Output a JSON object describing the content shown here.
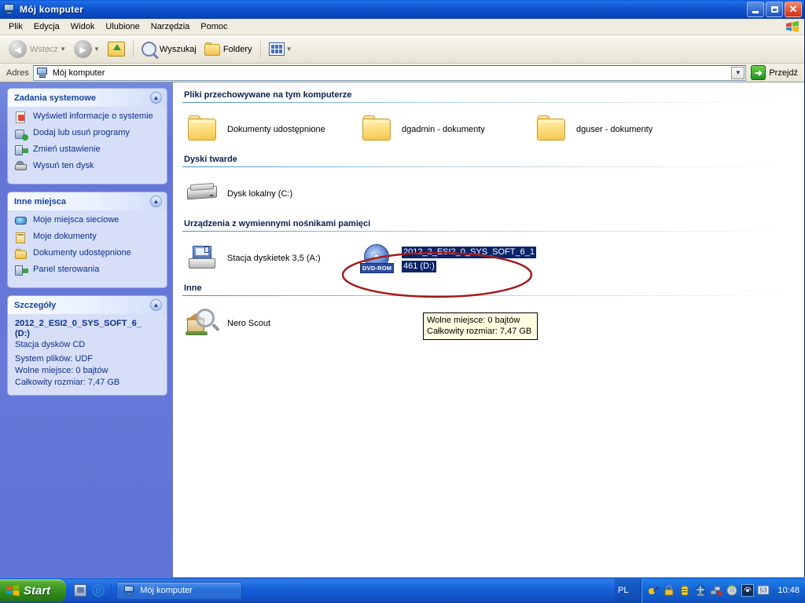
{
  "window": {
    "title": "Mój komputer",
    "icon": "my-computer-icon",
    "buttons": {
      "minimize": "_",
      "maximize": "❐",
      "close": "✕"
    }
  },
  "menubar": {
    "items": [
      {
        "label": "Plik"
      },
      {
        "label": "Edycja"
      },
      {
        "label": "Widok"
      },
      {
        "label": "Ulubione"
      },
      {
        "label": "Narzędzia"
      },
      {
        "label": "Pomoc"
      }
    ],
    "brand_icon": "windows-flag-icon"
  },
  "toolbar": {
    "back_label": "Wstecz",
    "forward_label": "",
    "up_label": "",
    "search_label": "Wyszukaj",
    "folders_label": "Foldery",
    "views_label": ""
  },
  "address": {
    "label": "Adres",
    "value": "Mój komputer",
    "go_label": "Przejdź"
  },
  "sidebar": {
    "panels": [
      {
        "title": "Zadania systemowe",
        "items": [
          {
            "label": "Wyświetl informacje o systemie",
            "icon": "system-info-icon"
          },
          {
            "label": "Dodaj lub usuń programy",
            "icon": "add-remove-programs-icon"
          },
          {
            "label": "Zmień ustawienie",
            "icon": "settings-icon"
          },
          {
            "label": "Wysuń ten dysk",
            "icon": "eject-disk-icon"
          }
        ]
      },
      {
        "title": "Inne miejsca",
        "items": [
          {
            "label": "Moje miejsca sieciowe",
            "icon": "network-places-icon"
          },
          {
            "label": "Moje dokumenty",
            "icon": "my-documents-icon"
          },
          {
            "label": "Dokumenty udostępnione",
            "icon": "shared-documents-icon"
          },
          {
            "label": "Panel sterowania",
            "icon": "control-panel-icon"
          }
        ]
      }
    ],
    "details": {
      "title": "Szczegóły",
      "name_line1": "2012_2_ESI2_0_SYS_SOFT_6_",
      "name_line2": "(D:)",
      "type": "Stacja dysków CD",
      "filesystem": "System plików: UDF",
      "free_space": "Wolne miejsce: 0 bajtów",
      "total_size": "Całkowity rozmiar: 7,47 GB"
    }
  },
  "content": {
    "groups": [
      {
        "header": "Pliki przechowywane na tym komputerze",
        "items": [
          {
            "label": "Dokumenty udostępnione",
            "icon": "folder-icon",
            "selected": false
          },
          {
            "label": "dgadmin - dokumenty",
            "icon": "folder-icon",
            "selected": false
          },
          {
            "label": "dguser - dokumenty",
            "icon": "folder-icon",
            "selected": false
          }
        ]
      },
      {
        "header": "Dyski twarde",
        "items": [
          {
            "label": "Dysk lokalny (C:)",
            "icon": "hard-disk-icon",
            "selected": false
          }
        ]
      },
      {
        "header": "Urządzenia z wymiennymi nośnikami pamięci",
        "items": [
          {
            "label": "Stacja dyskietek 3,5 (A:)",
            "icon": "floppy-drive-icon",
            "selected": false
          },
          {
            "label_line1": "2012_2_ESI2_0_SYS_SOFT_6_1",
            "label_line2": "461 (D:)",
            "icon": "dvd-rom-icon",
            "badge": "DVD-ROM",
            "selected": true
          }
        ]
      },
      {
        "header": "Inne",
        "items": [
          {
            "label": "Nero Scout",
            "icon": "nero-scout-icon",
            "selected": false
          }
        ]
      }
    ]
  },
  "tooltip": {
    "line1": "Wolne miejsce: 0 bajtów",
    "line2": "Całkowity rozmiar: 7,47 GB"
  },
  "annotation": {
    "shape": "ellipse",
    "color": "#a31b1b"
  },
  "taskbar": {
    "start_label": "Start",
    "quicklaunch": [
      {
        "icon": "show-desktop-icon"
      },
      {
        "icon": "internet-explorer-icon"
      }
    ],
    "tasks": [
      {
        "label": "Mój komputer",
        "icon": "my-computer-icon",
        "active": true
      }
    ],
    "tray": {
      "language": "PL",
      "icons": [
        "nero-tray-icon",
        "security-lock-icon",
        "battery-icon",
        "antivirus-icon",
        "network-disconnected-icon",
        "disc-tray-icon",
        "wireless-icon",
        "monitor-icon"
      ],
      "clock": "10:48"
    }
  },
  "colors": {
    "titlebar_blue": "#0f54cf",
    "sidebar_blue": "#6375d6",
    "panel_blue": "#d6dff7",
    "panel_title": "#16459e",
    "link_blue": "#0b2f8e",
    "selection": "#0a246a",
    "annotation_red": "#a31b1b",
    "tooltip_bg": "#ffffe1",
    "taskbar_blue": "#1861da",
    "start_green": "#2f8a1c"
  }
}
